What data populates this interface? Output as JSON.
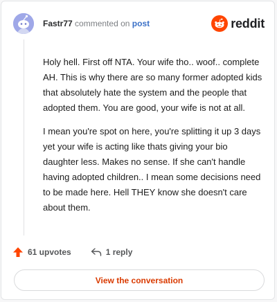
{
  "header": {
    "username": "Fastr77",
    "commented_text": "commented on",
    "post_link": "post",
    "brand": "reddit",
    "avatar_icon": "reddit-snoo-avatar-icon",
    "brand_icon": "reddit-alien-logo-icon",
    "brand_color": "#ff4500"
  },
  "comment": {
    "paragraphs": [
      "Holy hell. First off NTA. Your wife tho.. woof.. complete AH. This is why there are so many former adopted kids that absolutely hate the system and the people that adopted them. You are good, your wife is not at all.",
      "I mean you're spot on here, you're splitting it up 3 days yet your wife is acting like thats giving your bio daughter less. Makes no sense. If she can't handle having adopted children.. I mean some decisions need to be made here. Hell THEY know she doesn't care about them."
    ]
  },
  "actions": {
    "upvotes": "61 upvotes",
    "replies": "1 reply",
    "upvote_icon": "upvote-arrow-icon",
    "reply_icon": "reply-arrow-icon",
    "view_button": "View the conversation"
  }
}
